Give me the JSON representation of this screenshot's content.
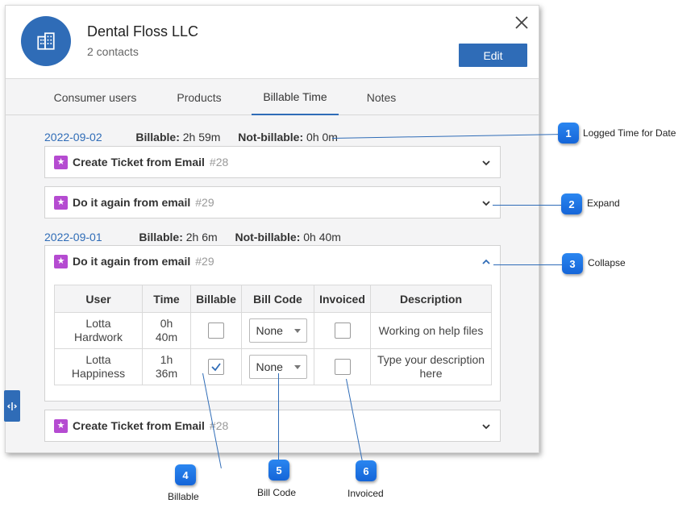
{
  "header": {
    "company_name": "Dental Floss LLC",
    "contacts": "2 contacts",
    "edit_label": "Edit"
  },
  "tabs": [
    {
      "label": "Consumer users",
      "active": false
    },
    {
      "label": "Products",
      "active": false
    },
    {
      "label": "Billable Time",
      "active": true
    },
    {
      "label": "Notes",
      "active": false
    }
  ],
  "groups": [
    {
      "date": "2022-09-02",
      "billable_label": "Billable:",
      "billable_value": "2h 59m",
      "nonbillable_label": "Not-billable:",
      "nonbillable_value": "0h 0m",
      "tickets": [
        {
          "title": "Create Ticket from Email",
          "number": "#28",
          "expanded": false
        },
        {
          "title": "Do it again from email",
          "number": "#29",
          "expanded": false
        }
      ]
    },
    {
      "date": "2022-09-01",
      "billable_label": "Billable:",
      "billable_value": "2h 6m",
      "nonbillable_label": "Not-billable:",
      "nonbillable_value": "0h 40m",
      "tickets": [
        {
          "title": "Do it again from email",
          "number": "#29",
          "expanded": true
        },
        {
          "title": "Create Ticket from Email",
          "number": "#28",
          "expanded": false
        }
      ]
    }
  ],
  "table": {
    "headers": [
      "User",
      "Time",
      "Billable",
      "Bill Code",
      "Invoiced",
      "Description"
    ],
    "rows": [
      {
        "user_first": "Lotta",
        "user_last": "Hardwork",
        "time_h": "0h",
        "time_m": "40m",
        "billable": false,
        "bill_code": "None",
        "invoiced": false,
        "description_1": "Working on help files",
        "description_2": ""
      },
      {
        "user_first": "Lotta",
        "user_last": "Happiness",
        "time_h": "1h",
        "time_m": "36m",
        "billable": true,
        "bill_code": "None",
        "invoiced": false,
        "description_1": "Type your description",
        "description_2": "here"
      }
    ]
  },
  "callouts": [
    {
      "num": "1",
      "label": "Logged Time for Date"
    },
    {
      "num": "2",
      "label": "Expand"
    },
    {
      "num": "3",
      "label": "Collapse"
    },
    {
      "num": "4",
      "label": "Billable"
    },
    {
      "num": "5",
      "label": "Bill Code"
    },
    {
      "num": "6",
      "label": "Invoiced"
    }
  ],
  "colors": {
    "accent": "#2f6cb7",
    "star_badge": "#b54bd1",
    "callout_badge": "#1a73e8"
  },
  "icons": {
    "avatar": "building-icon",
    "close": "close-icon",
    "ticket": "star-icon",
    "expand": "chevron-down-icon",
    "collapse": "chevron-up-icon",
    "side_handle": "resize-handle-icon"
  }
}
